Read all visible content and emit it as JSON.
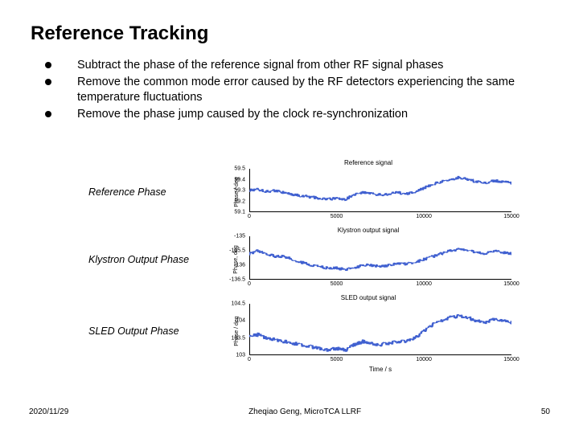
{
  "title": "Reference Tracking",
  "bullets": [
    "Subtract the phase of the reference signal from other RF signal phases",
    "Remove the common mode error caused by the RF detectors experiencing the same temperature fluctuations",
    "Remove the phase jump caused by the clock re-synchronization"
  ],
  "chart_labels": [
    "Reference Phase",
    "Klystron Output Phase",
    "SLED Output Phase"
  ],
  "chart_data": [
    {
      "type": "line",
      "title": "Reference signal",
      "ylabel": "Phase / deg",
      "xlabel": "",
      "xlim": [
        0,
        15000
      ],
      "ylim": [
        59.1,
        59.5
      ],
      "yticks": [
        "59.5",
        "59.4",
        "59.3",
        "59.2",
        "59.1"
      ],
      "xticks": [
        "0",
        "5000",
        "10000",
        "15000"
      ],
      "x": [
        0,
        500,
        1000,
        1500,
        2000,
        2500,
        3000,
        3500,
        4000,
        4500,
        5000,
        5500,
        6000,
        6500,
        7000,
        7500,
        8000,
        8500,
        9000,
        9500,
        10000,
        10500,
        11000,
        11500,
        12000,
        12500,
        13000,
        13500,
        14000,
        14500,
        15000
      ],
      "values": [
        59.3,
        59.31,
        59.29,
        59.3,
        59.28,
        59.26,
        59.25,
        59.24,
        59.23,
        59.22,
        59.23,
        59.22,
        59.26,
        59.28,
        59.27,
        59.26,
        59.27,
        59.28,
        59.27,
        59.29,
        59.32,
        59.36,
        59.38,
        59.4,
        59.42,
        59.4,
        59.38,
        59.37,
        59.39,
        59.38,
        59.37
      ]
    },
    {
      "type": "line",
      "title": "Klystron output signal",
      "ylabel": "Phase, deg",
      "xlabel": "",
      "xlim": [
        0,
        15000
      ],
      "ylim": [
        -136.5,
        -135
      ],
      "yticks": [
        "-135",
        "-135.5",
        "-136",
        "-136.5"
      ],
      "xticks": [
        "0",
        "5000",
        "10000",
        "15000"
      ],
      "x": [
        0,
        500,
        1000,
        1500,
        2000,
        2500,
        3000,
        3500,
        4000,
        4500,
        5000,
        5500,
        6000,
        6500,
        7000,
        7500,
        8000,
        8500,
        9000,
        9500,
        10000,
        10500,
        11000,
        11500,
        12000,
        12500,
        13000,
        13500,
        14000,
        14500,
        15000
      ],
      "values": [
        -135.6,
        -135.5,
        -135.6,
        -135.7,
        -135.7,
        -135.8,
        -135.9,
        -136.0,
        -136.05,
        -136.1,
        -136.1,
        -136.15,
        -136.1,
        -136.0,
        -136.0,
        -136.05,
        -136.0,
        -135.95,
        -135.95,
        -135.9,
        -135.8,
        -135.7,
        -135.6,
        -135.5,
        -135.45,
        -135.5,
        -135.55,
        -135.6,
        -135.5,
        -135.55,
        -135.6
      ]
    },
    {
      "type": "line",
      "title": "SLED output signal",
      "ylabel": "Phase / deg",
      "xlabel": "Time / s",
      "xlim": [
        0,
        15000
      ],
      "ylim": [
        103,
        104.5
      ],
      "yticks": [
        "104.5",
        "104",
        "103.5",
        "103"
      ],
      "xticks": [
        "0",
        "5000",
        "10000",
        "15000"
      ],
      "x": [
        0,
        500,
        1000,
        1500,
        2000,
        2500,
        3000,
        3500,
        4000,
        4500,
        5000,
        5500,
        6000,
        6500,
        7000,
        7500,
        8000,
        8500,
        9000,
        9500,
        10000,
        10500,
        11000,
        11500,
        12000,
        12500,
        13000,
        13500,
        14000,
        14500,
        15000
      ],
      "values": [
        103.55,
        103.6,
        103.5,
        103.45,
        103.4,
        103.35,
        103.3,
        103.25,
        103.2,
        103.15,
        103.2,
        103.15,
        103.3,
        103.4,
        103.35,
        103.3,
        103.35,
        103.4,
        103.4,
        103.5,
        103.7,
        103.9,
        104.0,
        104.1,
        104.15,
        104.1,
        104.0,
        103.95,
        104.05,
        104.0,
        103.95
      ]
    }
  ],
  "footer": {
    "date": "2020/11/29",
    "author": "Zheqiao Geng, MicroTCA LLRF",
    "page": "50"
  }
}
